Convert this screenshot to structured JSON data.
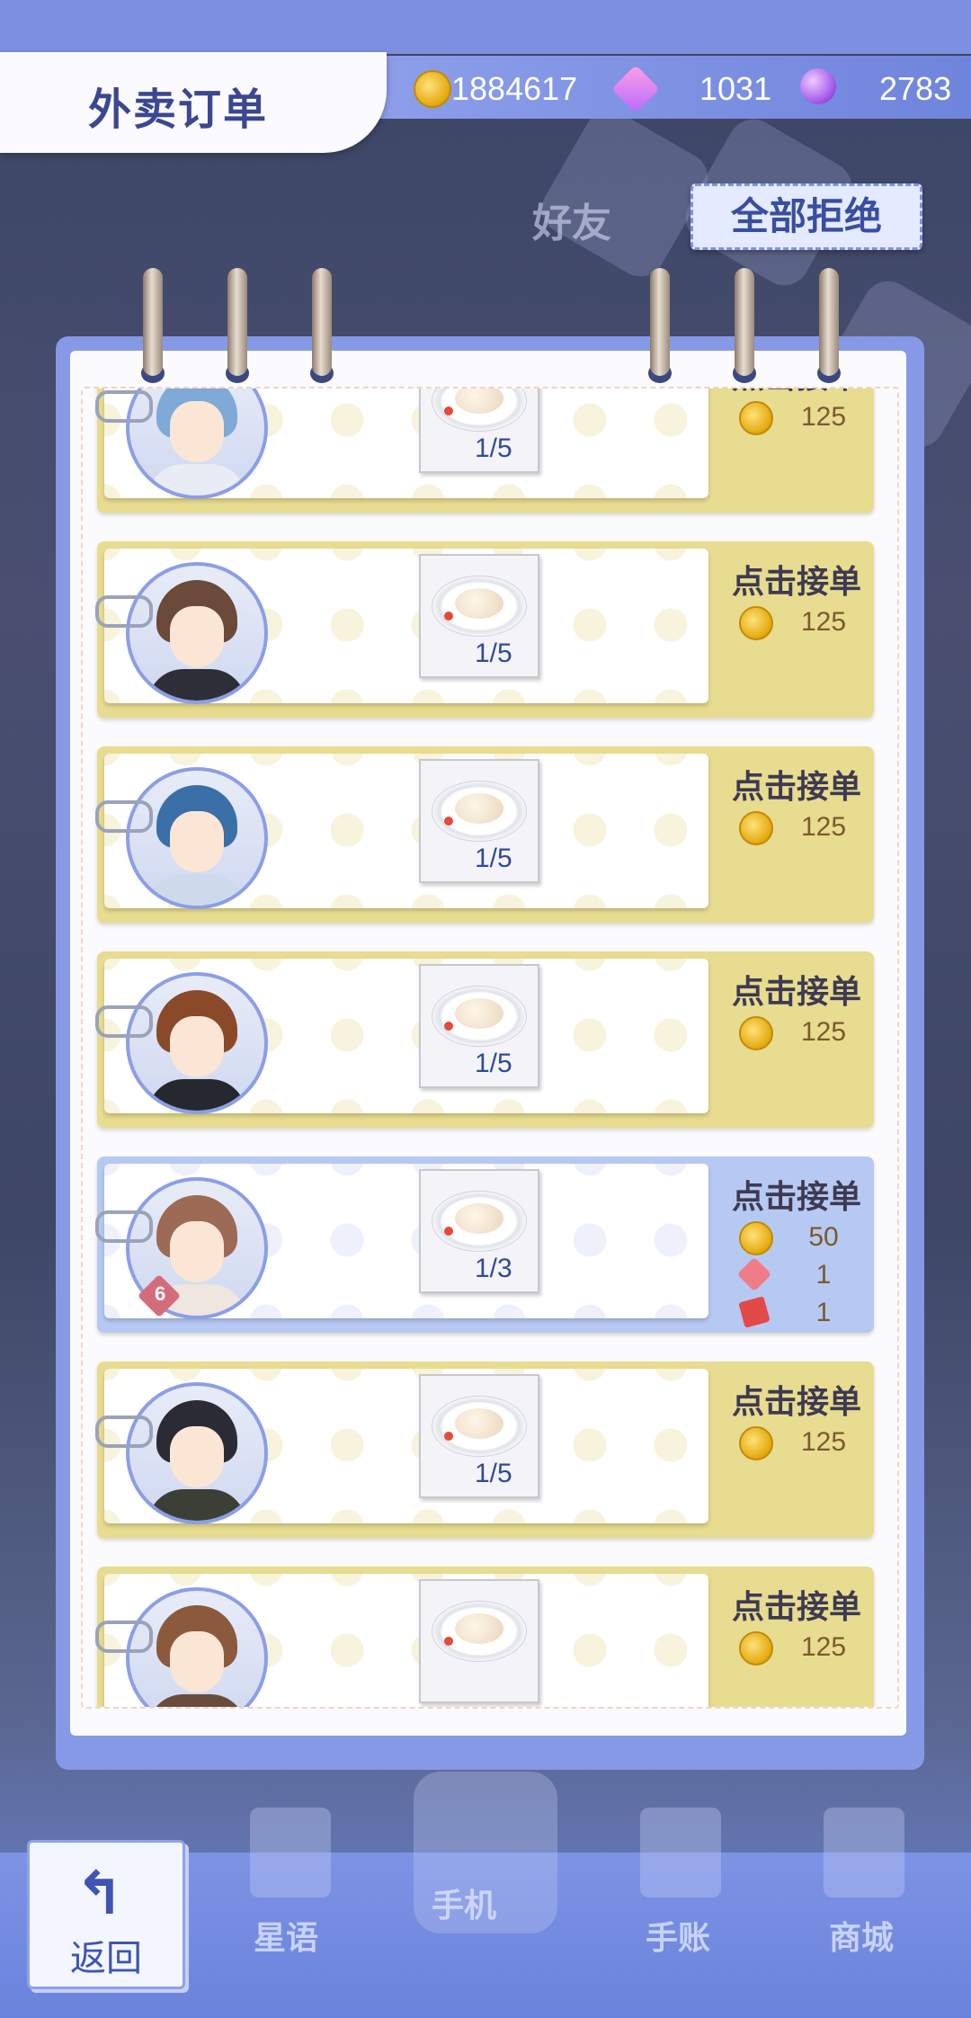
{
  "header": {
    "title": "外卖订单",
    "coins": "1884617",
    "gems": "1031",
    "orbs": "2783"
  },
  "actions": {
    "reject_all": "全部拒绝"
  },
  "background": {
    "friend_text": "好友"
  },
  "orders": [
    {
      "accept_label": "点击接单",
      "progress": "1/5",
      "rewards": [
        {
          "icon": "coin-icon",
          "value": "125"
        }
      ],
      "highlight": false
    },
    {
      "accept_label": "点击接单",
      "progress": "1/5",
      "rewards": [
        {
          "icon": "coin-icon",
          "value": "125"
        }
      ],
      "highlight": false
    },
    {
      "accept_label": "点击接单",
      "progress": "1/5",
      "rewards": [
        {
          "icon": "coin-icon",
          "value": "125"
        }
      ],
      "highlight": false
    },
    {
      "accept_label": "点击接单",
      "progress": "1/5",
      "rewards": [
        {
          "icon": "coin-icon",
          "value": "125"
        }
      ],
      "highlight": false
    },
    {
      "accept_label": "点击接单",
      "progress": "1/3",
      "affinity": "6",
      "rewards": [
        {
          "icon": "coin-icon",
          "value": "50"
        },
        {
          "icon": "heart-icon",
          "value": "1"
        },
        {
          "icon": "ticket-icon",
          "value": "1"
        }
      ],
      "highlight": true
    },
    {
      "accept_label": "点击接单",
      "progress": "1/5",
      "rewards": [
        {
          "icon": "coin-icon",
          "value": "125"
        }
      ],
      "highlight": false
    },
    {
      "accept_label": "点击接单",
      "progress": "",
      "rewards": [
        {
          "icon": "coin-icon",
          "value": "125"
        }
      ],
      "highlight": false
    }
  ],
  "bottom_nav": {
    "back": "返回",
    "star_words": "星语",
    "phone": "手机",
    "journal": "手账",
    "shop": "商城"
  }
}
